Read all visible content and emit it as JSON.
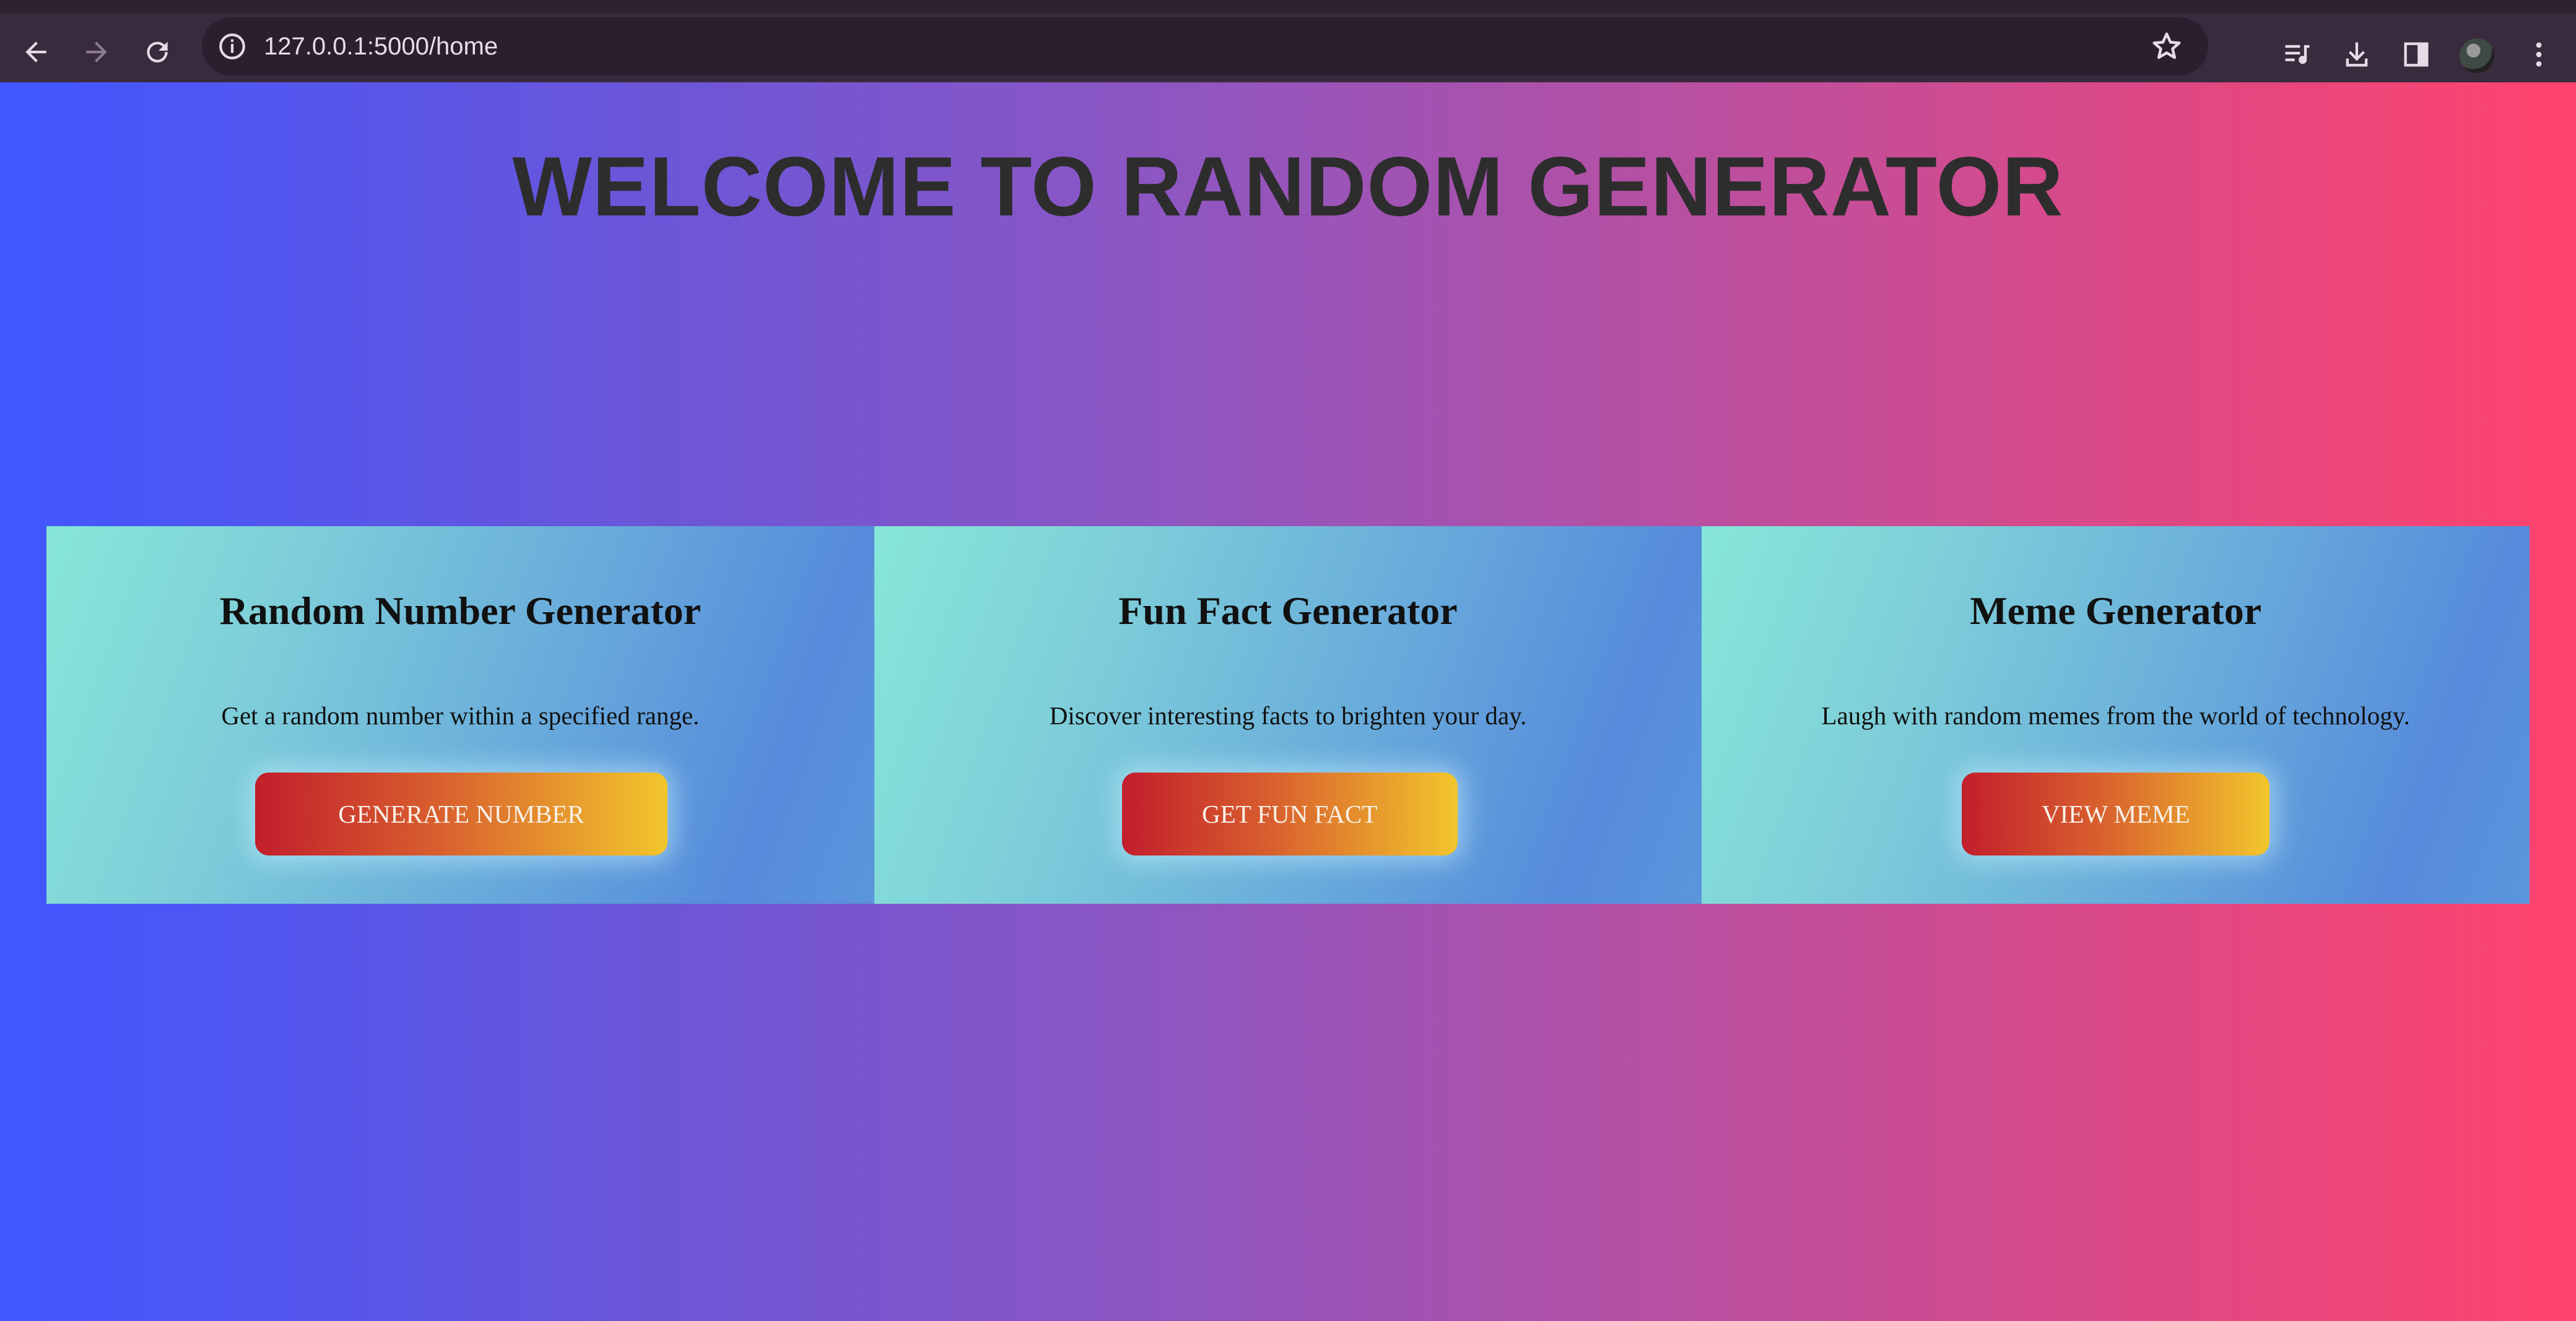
{
  "browser": {
    "url": "127.0.0.1:5000/home",
    "icons": [
      "back-icon",
      "forward-icon",
      "reload-icon",
      "info-icon",
      "star-icon",
      "media-icon",
      "download-icon",
      "side-panel-icon",
      "avatar",
      "menu-icon"
    ]
  },
  "page": {
    "title": "WELCOME TO RANDOM GENERATOR",
    "colors": {
      "gradient_start": "#4056ff",
      "gradient_end": "#ff426c",
      "card_gradient_start": "#86e6d8",
      "card_gradient_end": "#568bdb",
      "button_gradient_start": "#c21e2c",
      "button_gradient_end": "#f2c62c"
    },
    "cards": [
      {
        "title": "Random Number Generator",
        "description": "Get a random number within a specified range.",
        "button_label": "GENERATE NUMBER"
      },
      {
        "title": "Fun Fact Generator",
        "description": "Discover interesting facts to brighten your day.",
        "button_label": "GET FUN FACT"
      },
      {
        "title": "Meme Generator",
        "description": "Laugh with random memes from the world of technology.",
        "button_label": "VIEW MEME"
      }
    ]
  }
}
